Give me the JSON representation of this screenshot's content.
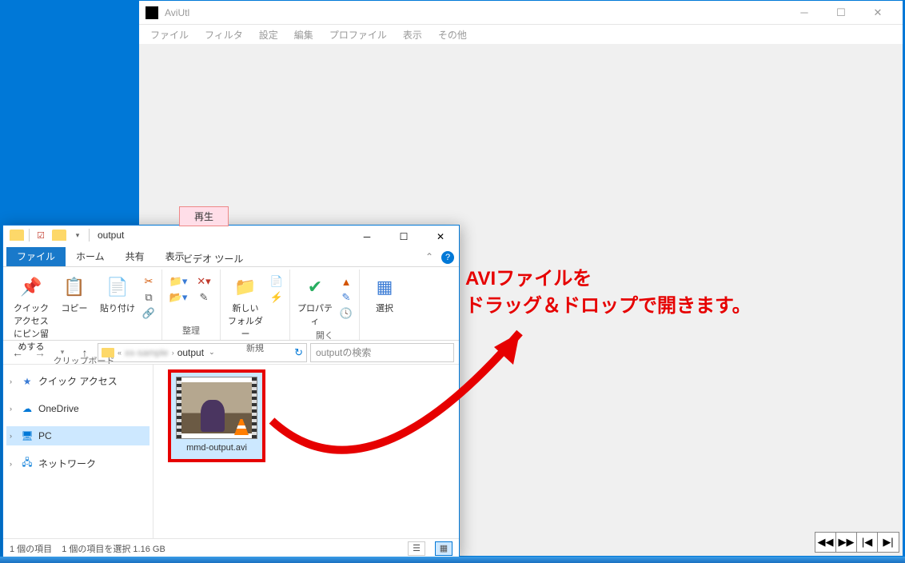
{
  "aviutl": {
    "title": "AviUtl",
    "menus": [
      "ファイル",
      "フィルタ",
      "設定",
      "編集",
      "プロファイル",
      "表示",
      "その他"
    ],
    "playback": [
      "◀◀",
      "▶▶",
      "|◀",
      "▶|"
    ]
  },
  "explorer": {
    "title": "output",
    "context_tab": "再生",
    "context_sub": "ビデオ ツール",
    "tabs": [
      "ファイル",
      "ホーム",
      "共有",
      "表示"
    ],
    "active_tab": 0,
    "ribbon": {
      "group1": {
        "pin": "クイック アクセス\nにピン留めする",
        "copy": "コピー",
        "paste": "貼り付け",
        "label": "クリップボード"
      },
      "group2": {
        "label": "整理"
      },
      "group3": {
        "newfolder": "新しい\nフォルダー",
        "label": "新規"
      },
      "group4": {
        "prop": "プロパティ",
        "label": "開く"
      },
      "group5": {
        "select": "選択"
      }
    },
    "breadcrumb": {
      "mid": "xx-sample",
      "last": "output"
    },
    "search_placeholder": "outputの検索",
    "nav": {
      "quick": "クイック アクセス",
      "onedrive": "OneDrive",
      "pc": "PC",
      "network": "ネットワーク"
    },
    "file": {
      "name": "mmd-output.avi"
    },
    "status": {
      "count": "1 個の項目",
      "selected": "1 個の項目を選択 1.16 GB"
    }
  },
  "annotation": {
    "line1": "AVIファイルを",
    "line2": "ドラッグ＆ドロップで開きます。"
  }
}
